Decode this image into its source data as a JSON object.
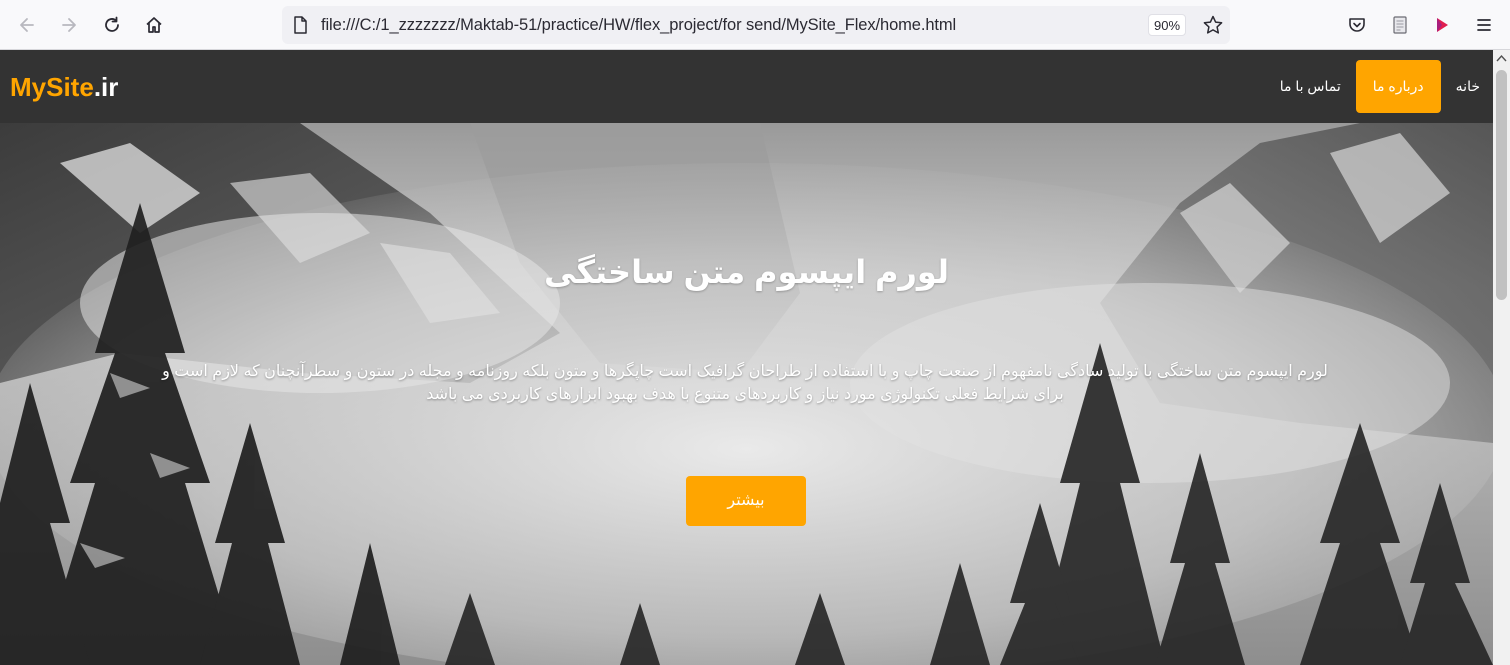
{
  "browser": {
    "url": "file:///C:/1_zzzzzzz/Maktab-51/practice/HW/flex_project/for send/MySite_Flex/home.html",
    "zoom": "90%",
    "icons": [
      "back-icon",
      "forward-icon",
      "reload-icon",
      "home-icon",
      "page-icon",
      "bookmark-star-icon",
      "pocket-icon",
      "reader-view-icon",
      "extension-icon",
      "menu-icon"
    ]
  },
  "site": {
    "logo_brand": "MySite",
    "logo_tld": ".ir",
    "nav": [
      {
        "label": "خانه",
        "active": false
      },
      {
        "label": "درباره ما",
        "active": true
      },
      {
        "label": "تماس با ما",
        "active": false
      }
    ]
  },
  "hero": {
    "title": "لورم ایپسوم متن ساختگی",
    "text": "لورم ایپسوم متن ساختگی با تولید سادگی نامفهوم از صنعت چاپ و با استفاده از طراحان گرافیک است چاپگرها و متون بلکه روزنامه و مجله در ستون و سطرآنچنان که لازم است و برای شرایط فعلی تکنولوژی مورد نیاز و کاربردهای متنوع با هدف بهبود ابزارهای کاربردی می باشد",
    "button_label": "بیشتر"
  },
  "colors": {
    "accent": "#ffa500",
    "header_bg": "#333333",
    "text_light": "#ffffff"
  }
}
